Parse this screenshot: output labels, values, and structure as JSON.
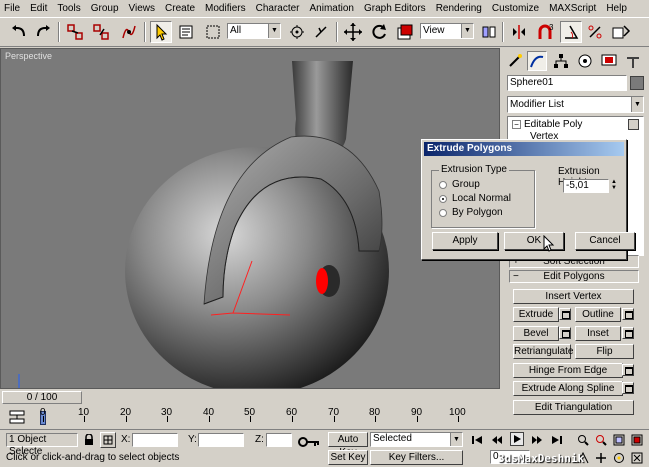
{
  "menu": [
    "File",
    "Edit",
    "Tools",
    "Group",
    "Views",
    "Create",
    "Modifiers",
    "Character",
    "Animation",
    "Graph Editors",
    "Rendering",
    "Customize",
    "MAXScript",
    "Help"
  ],
  "toolbar": {
    "selection_filter": "All",
    "coord_system": "View"
  },
  "viewport": {
    "label": "Perspective"
  },
  "command_panel": {
    "object_name": "Sphere01",
    "modifier_list": "Modifier List",
    "stack_item": "Editable Poly",
    "stack_subitem": "Vertex",
    "rollouts": {
      "soft_selection": "Soft Selection",
      "edit_polygons": "Edit Polygons"
    },
    "buttons": {
      "insert_vertex": "Insert Vertex",
      "extrude": "Extrude",
      "outline": "Outline",
      "bevel": "Bevel",
      "inset": "Inset",
      "retriangulate": "Retriangulate",
      "flip": "Flip",
      "hinge_from_edge": "Hinge From Edge",
      "extrude_along_spline": "Extrude Along Spline",
      "edit_triangulation": "Edit Triangulation"
    }
  },
  "dialog": {
    "title": "Extrude Polygons",
    "group_label": "Extrusion Type",
    "options": [
      "Group",
      "Local Normal",
      "By Polygon"
    ],
    "selected_option": "Local Normal",
    "height_label": "Extrusion Height:",
    "height_value": "-5,01",
    "apply": "Apply",
    "ok": "OK",
    "cancel": "Cancel"
  },
  "timeline": {
    "frame_display": "0 / 100",
    "ticks": [
      "0",
      "10",
      "20",
      "30",
      "40",
      "50",
      "60",
      "70",
      "80",
      "90",
      "100"
    ]
  },
  "status": {
    "selection_info": "1 Object Selecte",
    "x_label": "X:",
    "y_label": "Y:",
    "z_label": "Z:",
    "prompt": "Click or click-and-drag to select objects",
    "auto_key": "Auto Key",
    "set_key": "Set Key",
    "key_mode": "Selected",
    "key_filters": "Key Filters...",
    "frame": "0"
  },
  "watermark": "3dsMaxDeshnik"
}
